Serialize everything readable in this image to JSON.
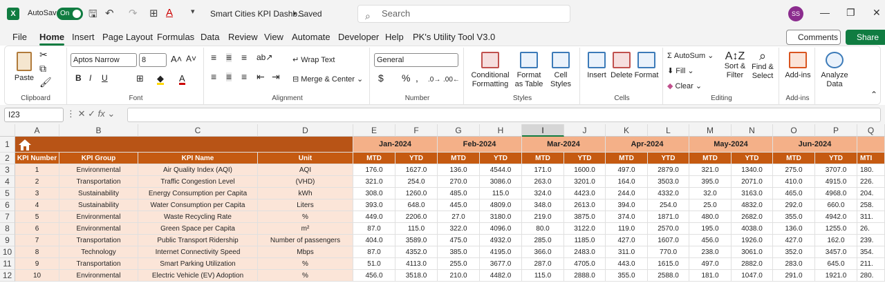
{
  "titlebar": {
    "autosave_label": "AutoSave",
    "autosave_state": "On",
    "doc_title": "Smart Cities KPI Dashb...",
    "saved": "• Saved",
    "search_placeholder": "Search",
    "user_initials": "SS"
  },
  "tabs": [
    "File",
    "Home",
    "Insert",
    "Page Layout",
    "Formulas",
    "Data",
    "Review",
    "View",
    "Automate",
    "Developer",
    "Help",
    "PK's Utility Tool V3.0"
  ],
  "active_tab": "Home",
  "comments_label": "Comments",
  "share_label": "Share",
  "ribbon": {
    "clipboard": {
      "paste": "Paste",
      "group": "Clipboard"
    },
    "font": {
      "name": "Aptos Narrow",
      "size": "8",
      "group": "Font"
    },
    "alignment": {
      "wrap": "Wrap Text",
      "merge": "Merge & Center",
      "group": "Alignment"
    },
    "number": {
      "format": "General",
      "group": "Number"
    },
    "styles": {
      "conditional": "Conditional Formatting",
      "format_table": "Format as Table",
      "cell_styles": "Cell Styles",
      "group": "Styles"
    },
    "cells": {
      "insert": "Insert",
      "delete": "Delete",
      "format": "Format",
      "group": "Cells"
    },
    "editing": {
      "autosum": "AutoSum",
      "fill": "Fill",
      "clear": "Clear",
      "sort": "Sort & Filter",
      "find": "Find & Select",
      "group": "Editing"
    },
    "addins": {
      "addins": "Add-ins",
      "group": "Add-ins"
    },
    "analyze": {
      "label": "Analyze Data"
    }
  },
  "name_box": "I23",
  "fx_label": "fx",
  "columns": [
    "A",
    "B",
    "C",
    "D",
    "E",
    "F",
    "G",
    "H",
    "I",
    "J",
    "K",
    "L",
    "M",
    "N",
    "O",
    "P",
    "Q"
  ],
  "row_numbers": [
    "1",
    "2",
    "3",
    "4",
    "5",
    "6",
    "7",
    "8",
    "9",
    "10",
    "11",
    "12"
  ],
  "headers": {
    "kpi_number": "KPI Number",
    "kpi_group": "KPI Group",
    "kpi_name": "KPI Name",
    "unit": "Unit",
    "months": [
      "Jan-2024",
      "Feb-2024",
      "Mar-2024",
      "Apr-2024",
      "May-2024",
      "Jun-2024"
    ],
    "mtd": "MTD",
    "ytd": "YTD",
    "mtd_partial": "MTI"
  },
  "rows": [
    {
      "num": "1",
      "group": "Environmental",
      "name": "Air Quality Index (AQI)",
      "unit": "AQI",
      "vals": [
        "176.0",
        "1627.0",
        "136.0",
        "4544.0",
        "171.0",
        "1600.0",
        "497.0",
        "2879.0",
        "321.0",
        "1340.0",
        "275.0",
        "3707.0",
        "180."
      ]
    },
    {
      "num": "2",
      "group": "Transportation",
      "name": "Traffic Congestion Level",
      "unit": "(VHD)",
      "vals": [
        "321.0",
        "254.0",
        "270.0",
        "3086.0",
        "263.0",
        "3201.0",
        "164.0",
        "3503.0",
        "395.0",
        "2071.0",
        "410.0",
        "4915.0",
        "226."
      ]
    },
    {
      "num": "3",
      "group": "Sustainability",
      "name": "Energy Consumption per Capita",
      "unit": "kWh",
      "vals": [
        "308.0",
        "1260.0",
        "485.0",
        "115.0",
        "324.0",
        "4423.0",
        "244.0",
        "4332.0",
        "32.0",
        "3163.0",
        "465.0",
        "4968.0",
        "204."
      ]
    },
    {
      "num": "4",
      "group": "Sustainability",
      "name": "Water Consumption per Capita",
      "unit": "Liters",
      "vals": [
        "393.0",
        "648.0",
        "445.0",
        "4809.0",
        "348.0",
        "2613.0",
        "394.0",
        "254.0",
        "25.0",
        "4832.0",
        "292.0",
        "660.0",
        "258."
      ]
    },
    {
      "num": "5",
      "group": "Environmental",
      "name": "Waste Recycling Rate",
      "unit": "%",
      "vals": [
        "449.0",
        "2206.0",
        "27.0",
        "3180.0",
        "219.0",
        "3875.0",
        "374.0",
        "1871.0",
        "480.0",
        "2682.0",
        "355.0",
        "4942.0",
        "311."
      ]
    },
    {
      "num": "6",
      "group": "Environmental",
      "name": "Green Space per Capita",
      "unit": "m²",
      "vals": [
        "87.0",
        "115.0",
        "322.0",
        "4096.0",
        "80.0",
        "3122.0",
        "119.0",
        "2570.0",
        "195.0",
        "4038.0",
        "136.0",
        "1255.0",
        "26."
      ]
    },
    {
      "num": "7",
      "group": "Transportation",
      "name": "Public Transport Ridership",
      "unit": "Number of passengers",
      "vals": [
        "404.0",
        "3589.0",
        "475.0",
        "4932.0",
        "285.0",
        "1185.0",
        "427.0",
        "1607.0",
        "456.0",
        "1926.0",
        "427.0",
        "162.0",
        "239."
      ]
    },
    {
      "num": "8",
      "group": "Technology",
      "name": "Internet Connectivity Speed",
      "unit": "Mbps",
      "vals": [
        "87.0",
        "4352.0",
        "385.0",
        "4195.0",
        "366.0",
        "2483.0",
        "311.0",
        "770.0",
        "238.0",
        "3061.0",
        "352.0",
        "3457.0",
        "354."
      ]
    },
    {
      "num": "9",
      "group": "Transportation",
      "name": "Smart Parking Utilization",
      "unit": "%",
      "vals": [
        "51.0",
        "4113.0",
        "255.0",
        "3677.0",
        "287.0",
        "4705.0",
        "443.0",
        "1615.0",
        "497.0",
        "2882.0",
        "283.0",
        "645.0",
        "211."
      ]
    },
    {
      "num": "10",
      "group": "Environmental",
      "name": "Electric Vehicle (EV) Adoption",
      "unit": "%",
      "vals": [
        "456.0",
        "3518.0",
        "210.0",
        "4482.0",
        "115.0",
        "2888.0",
        "355.0",
        "2588.0",
        "181.0",
        "1047.0",
        "291.0",
        "1921.0",
        "280."
      ]
    }
  ]
}
